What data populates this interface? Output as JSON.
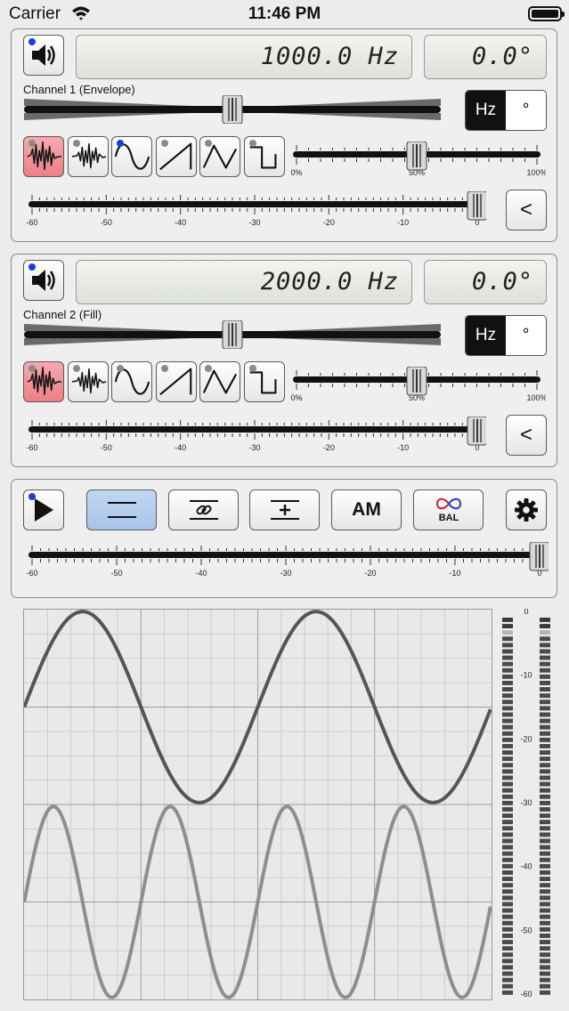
{
  "status_bar": {
    "carrier": "Carrier",
    "time": "11:46 PM"
  },
  "channel1": {
    "frequency": "1000.0 Hz",
    "phase": "0.0°",
    "label": "Channel 1 (Envelope)",
    "unit_hz": "Hz",
    "unit_deg": "°",
    "back_button": "<",
    "balance_level": 0.5,
    "duty_level": 0.5,
    "volume_level": 1.0,
    "selected_wave": "white-noise"
  },
  "channel2": {
    "frequency": "2000.0 Hz",
    "phase": "0.0°",
    "label": "Channel 2 (Fill)",
    "unit_hz": "Hz",
    "unit_deg": "°",
    "back_button": "<",
    "balance_level": 0.5,
    "duty_level": 0.5,
    "volume_level": 1.0,
    "selected_wave": "white-noise"
  },
  "waveforms": [
    "white-noise",
    "pink-noise",
    "sine",
    "sawtooth",
    "triangle",
    "square"
  ],
  "pct_ticks": [
    "0%",
    "50%",
    "100%"
  ],
  "db_ticks": [
    "-60",
    "-50",
    "-40",
    "-30",
    "-20",
    "-10",
    "0"
  ],
  "master": {
    "modes": [
      "split",
      "link",
      "sum",
      "am",
      "bal"
    ],
    "selected_mode": "split",
    "am_label": "AM",
    "bal_label": "BAL",
    "volume_level": 1.0
  },
  "scope": {
    "ch1_cycles": 2,
    "ch2_cycles": 4
  },
  "meter": {
    "ticks": [
      "0",
      "-10",
      "-20",
      "-30",
      "-40",
      "-50",
      "-60"
    ]
  },
  "colors": {
    "selected_wave_bg": "#ef7f86",
    "selected_mode_bg": "#a9c3ea",
    "active_dot": "#1a3fd9",
    "trace1": "#555555",
    "trace2": "#8e8e8e"
  }
}
